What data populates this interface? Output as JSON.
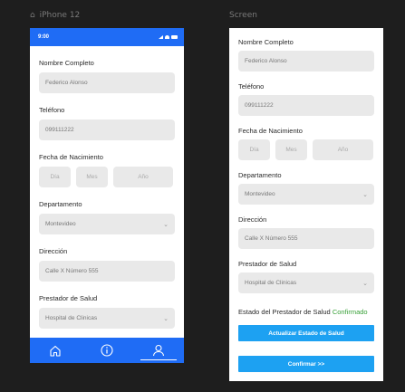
{
  "frames": {
    "left_title": "iPhone 12",
    "right_title": "Screen"
  },
  "status_bar": {
    "time": "9:00"
  },
  "form": {
    "nombre_label": "Nombre Completo",
    "nombre_value": "Federico Alonso",
    "telefono_label": "Teléfono",
    "telefono_value": "099111222",
    "fecha_label": "Fecha de Nacimiento",
    "dia_placeholder": "Día",
    "mes_placeholder": "Mes",
    "ano_placeholder": "Año",
    "departamento_label": "Departamento",
    "departamento_value": "Montevideo",
    "direccion_label": "Dirección",
    "direccion_value": "Calle X Número 555",
    "prestador_label": "Prestador de Salud",
    "prestador_value": "Hospital de Clinicas",
    "estado_label": "Estado del Prestador de Salud",
    "estado_value": "Confirmado"
  },
  "buttons": {
    "actualizar": "Actualizar Estado de Salud",
    "confirmar": "Confirmar >>"
  },
  "tab_bar": {
    "tabs": [
      {
        "icon": "home-icon",
        "active": false
      },
      {
        "icon": "info-icon",
        "active": false
      },
      {
        "icon": "user-icon",
        "active": true
      }
    ]
  },
  "colors": {
    "primary": "#1f6cf5",
    "button": "#1da1f2",
    "confirmed": "#3aa13a",
    "input_bg": "#e9e9e9",
    "canvas": "#1e1e1e"
  }
}
